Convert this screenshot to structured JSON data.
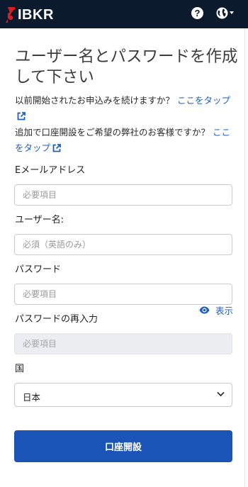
{
  "header": {
    "logo_text": "IBKR",
    "help_icon": "question-circle-icon",
    "help_glyph": "?",
    "language_icon": "globe-icon",
    "background": "#0c1a2e",
    "logo_accent": "#d81e26"
  },
  "main": {
    "title": "ユーザー名とパスワードを作成して下さい",
    "resume": {
      "text": "以前開始されたお申込みを続けますか？",
      "link": "ここをタップ",
      "icon": "external-link-icon"
    },
    "existing": {
      "text": "追加で口座開設をご希望の弊社のお客様ですか？",
      "link": "ここをタップ",
      "icon": "external-link-icon"
    }
  },
  "form": {
    "email": {
      "label": "Eメールアドレス",
      "placeholder": "必要項目",
      "value": ""
    },
    "username": {
      "label": "ユーザー名:",
      "placeholder": "必須（英語のみ）",
      "value": ""
    },
    "password": {
      "label": "パスワード",
      "placeholder": "必要項目",
      "value": ""
    },
    "show_password": {
      "label": "表示",
      "icon": "eye-icon"
    },
    "password_confirm": {
      "label": "パスワードの再入力",
      "placeholder": "必要項目",
      "value": ""
    },
    "country": {
      "label": "国",
      "value": "日本",
      "icon": "chevron-down-icon"
    },
    "submit_label": "口座開設"
  },
  "colors": {
    "primary_button": "#1a54b7",
    "link": "#1f5fc0"
  }
}
